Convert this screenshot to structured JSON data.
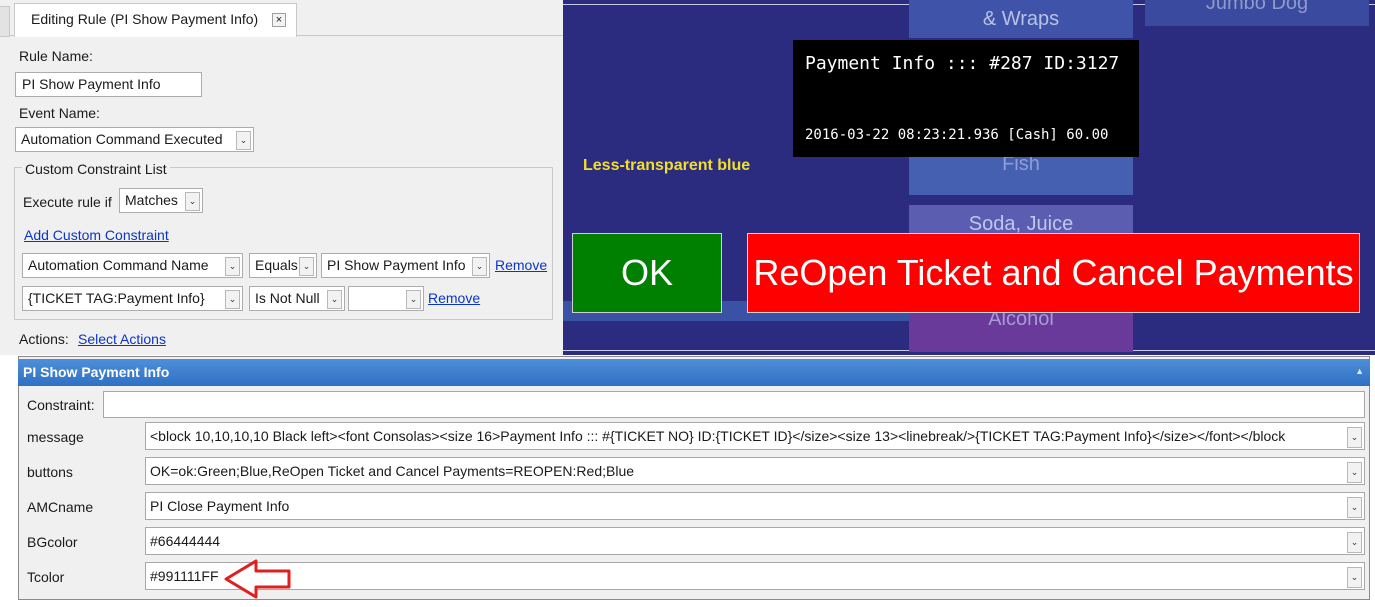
{
  "tab": {
    "title": "Editing Rule (PI Show Payment Info)",
    "close_glyph": "×"
  },
  "form": {
    "rule_name_label": "Rule Name:",
    "rule_name_value": "PI Show Payment Info",
    "event_name_label": "Event Name:",
    "event_name_value": "Automation Command Executed",
    "constraint_group_title": "Custom Constraint List",
    "execute_rule_if_label": "Execute rule if",
    "execute_rule_if_value": "Matches",
    "add_constraint_link": "Add Custom Constraint",
    "constraints": [
      {
        "field": "Automation Command Name",
        "operator": "Equals",
        "value": "PI Show Payment Info",
        "remove": "Remove"
      },
      {
        "field": "{TICKET TAG:Payment Info}",
        "operator": "Is Not Null",
        "value": "",
        "remove": "Remove"
      }
    ],
    "actions_label": "Actions:",
    "select_actions_link": "Select Actions"
  },
  "preview": {
    "background_tiles": [
      "& Wraps",
      "Jumbo Dog",
      "Fish",
      "Soda, Juice",
      "Alcohol"
    ],
    "popup_title": "Payment Info ::: #287 ID:3127",
    "popup_line": "2016-03-22 08:23:21.936 [Cash] 60.00",
    "annotation": "Less-transparent blue",
    "ok_button": "OK",
    "reopen_button": "ReOpen Ticket and Cancel Payments",
    "colors": {
      "ok": "#008000",
      "reopen": "#FF0000",
      "annotation": "#F2DF28"
    }
  },
  "action_panel": {
    "title": "PI Show Payment Info",
    "rows": [
      {
        "label": "Constraint:",
        "value": ""
      },
      {
        "label": "message",
        "value": "<block 10,10,10,10 Black left><font Consolas><size 16>Payment Info ::: #{TICKET NO} ID:{TICKET ID}</size><size 13><linebreak/>{TICKET TAG:Payment Info}</size></font></block"
      },
      {
        "label": "buttons",
        "value": "OK=ok:Green;Blue,ReOpen Ticket and Cancel Payments=REOPEN:Red;Blue"
      },
      {
        "label": "AMCname",
        "value": "PI Close Payment Info"
      },
      {
        "label": "BGcolor",
        "value": "#66444444"
      },
      {
        "label": "Tcolor",
        "value": "#991111FF"
      }
    ]
  }
}
